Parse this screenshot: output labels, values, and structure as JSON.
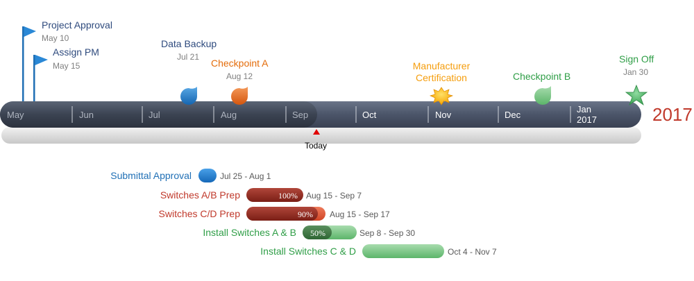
{
  "year_label": "2017",
  "today": {
    "label": "Today"
  },
  "months": [
    "May",
    "Jun",
    "Jul",
    "Aug",
    "Sep",
    "Oct",
    "Nov",
    "Dec",
    "Jan\n2017"
  ],
  "milestones": {
    "project_approval": {
      "title": "Project Approval",
      "date": "May 10",
      "color": "#2e4a7d"
    },
    "assign_pm": {
      "title": "Assign PM",
      "date": "May 15",
      "color": "#2e4a7d"
    },
    "data_backup": {
      "title": "Data Backup",
      "date": "Jul 21",
      "color": "#2e4a7d"
    },
    "checkpoint_a": {
      "title": "Checkpoint A",
      "date": "Aug 12",
      "color": "#e46c0a"
    },
    "manufacturer_certification": {
      "title": "Manufacturer\nCertification",
      "date": "",
      "color": "#f59d0c"
    },
    "checkpoint_b": {
      "title": "Checkpoint B",
      "color": "#2f9e47"
    },
    "sign_off": {
      "title": "Sign Off",
      "date": "Jan 30",
      "color": "#2f9e47"
    }
  },
  "tasks": [
    {
      "label": "Submittal Approval",
      "dates": "Jul 25 - Aug 1",
      "percent": "",
      "color": "#1f6fb5"
    },
    {
      "label": "Switches A/B Prep",
      "dates": "Aug 15 - Sep 7",
      "percent": "100%",
      "color": "#c0392b"
    },
    {
      "label": "Switches C/D Prep",
      "dates": "Aug 15 - Sep 17",
      "percent": "90%",
      "color": "#c0392b"
    },
    {
      "label": "Install Switches A & B",
      "dates": "Sep 8 - Sep 30",
      "percent": "50%",
      "color": "#2f9e47"
    },
    {
      "label": "Install Switches C & D",
      "dates": "Oct 4 - Nov 7",
      "percent": "",
      "color": "#2f9e47"
    }
  ],
  "colors": {
    "timeline_past": "#3f4756",
    "timeline_future": "#4a5468",
    "today_marker": "#e00000"
  }
}
